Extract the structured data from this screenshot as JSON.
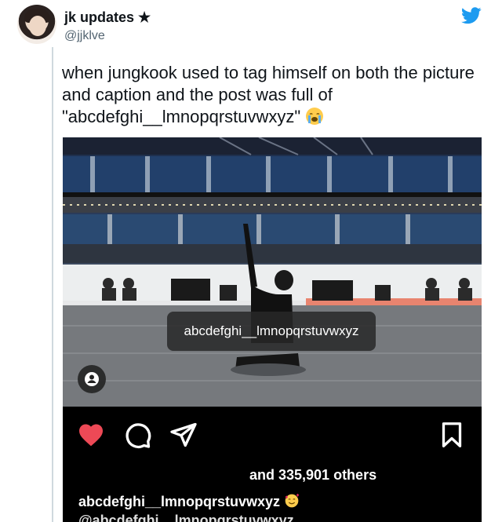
{
  "tweet": {
    "author": {
      "display_name": "jk updates ★",
      "handle": "@jjklve"
    },
    "text": "when jungkook used to tag himself on both the picture and caption and the post was full of \"abcdefghi__lmnopqrstuvwxyz\"",
    "text_emoji": "loudly-crying-face",
    "platform_icon": "twitter-bird-icon",
    "brand_color": "#1d9bf0"
  },
  "post": {
    "photo_tag": "abcdefghi__lmnopqrstuvwxyz",
    "liked": true,
    "like_color": "#ed4956",
    "likes_text": "and 335,901 others",
    "caption": "abcdefghi__lmnopqrstuvwxyz",
    "caption_emoji": "smiling-face-with-hearts",
    "caption_second_line": "@abcdefghi__lmnopqrstuvwxyz"
  }
}
